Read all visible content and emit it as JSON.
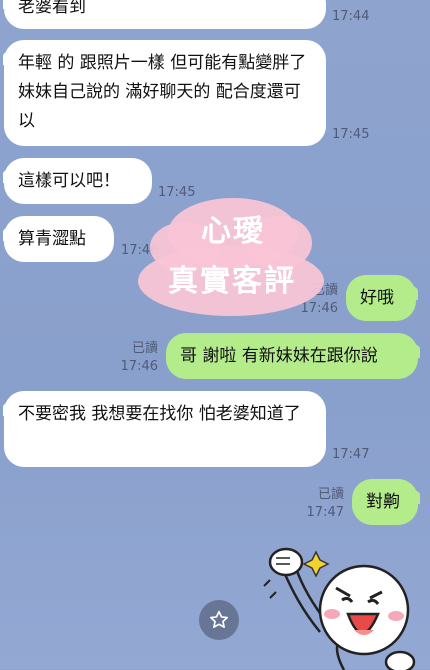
{
  "messages": [
    {
      "side": "in",
      "text": "老婆看到",
      "time": "17:44"
    },
    {
      "side": "in",
      "text": "年輕 的 跟照片一樣 但可能有點變胖了 妹妹自己說的 滿好聊天的 配合度還可以",
      "time": "17:45"
    },
    {
      "side": "in",
      "text": "這樣可以吧！",
      "time": "17:45"
    },
    {
      "side": "in",
      "text": "算青澀點",
      "time": "17:46"
    },
    {
      "side": "out",
      "text": "好哦",
      "read": "已讀",
      "time": "17:46"
    },
    {
      "side": "out",
      "text": "哥 謝啦 有新妹妹在跟你說",
      "read": "已讀",
      "time": "17:46"
    },
    {
      "side": "in",
      "text": "不要密我 我想要在找你 怕老婆知道了",
      "time": "17:47"
    },
    {
      "side": "out",
      "text": "對齁",
      "read": "已讀",
      "time": "17:47"
    }
  ],
  "watermark": {
    "line1": "心璦",
    "line2": "真實客評"
  },
  "icons": {
    "favorite": "star-icon",
    "sticker": "cheering-character-sticker"
  },
  "colors": {
    "background": "#8ea4cf",
    "incoming": "#ffffff",
    "outgoing": "#b4ec8c",
    "watermark": "#fac6d6"
  }
}
